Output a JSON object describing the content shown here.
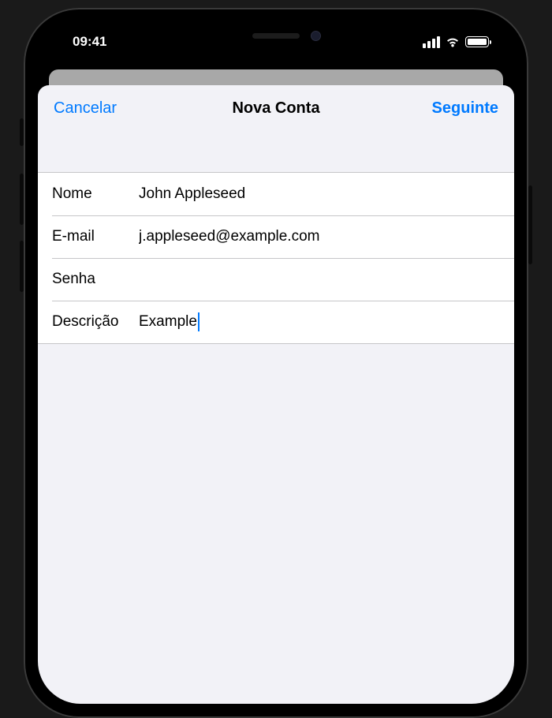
{
  "status_bar": {
    "time": "09:41"
  },
  "modal": {
    "title": "Nova Conta",
    "cancel_label": "Cancelar",
    "next_label": "Seguinte"
  },
  "form": {
    "name": {
      "label": "Nome",
      "value": "John Appleseed"
    },
    "email": {
      "label": "E-mail",
      "value": "j.appleseed@example.com"
    },
    "password": {
      "label": "Senha",
      "value": ""
    },
    "description": {
      "label": "Descrição",
      "value": "Example"
    }
  }
}
